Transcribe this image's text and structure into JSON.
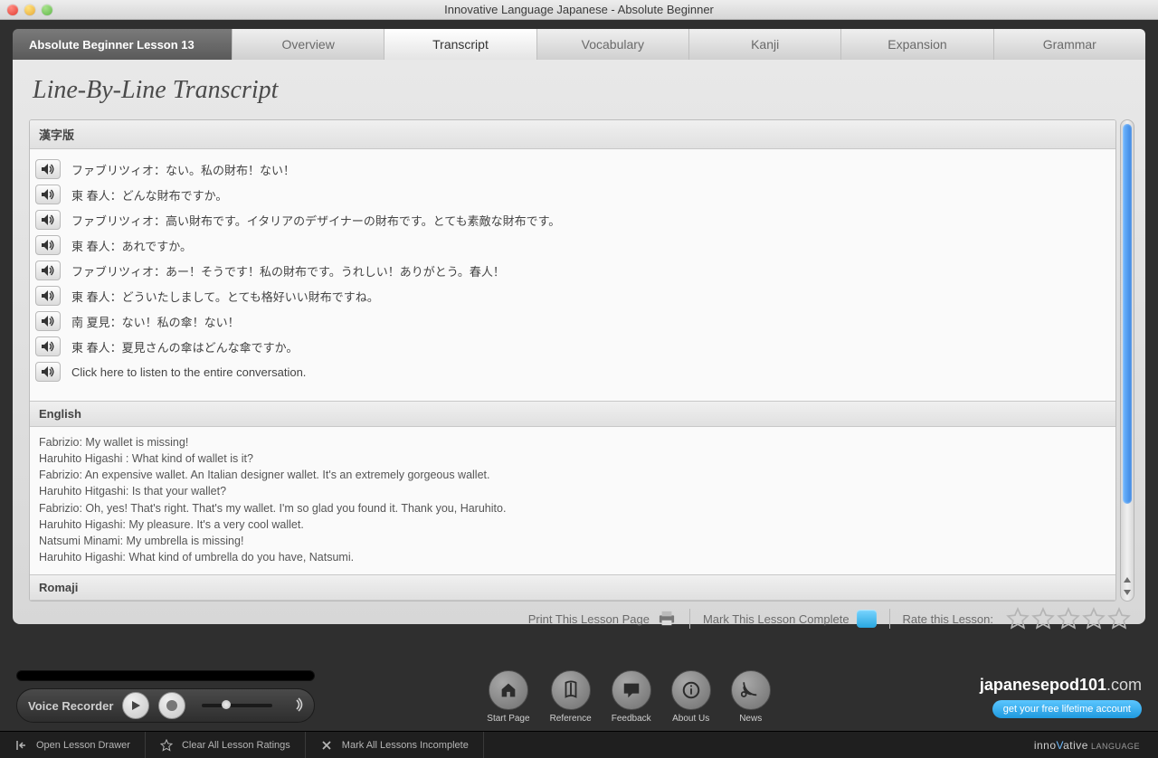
{
  "window": {
    "title": "Innovative Language Japanese - Absolute Beginner"
  },
  "lesson_tag": "Absolute Beginner Lesson 13",
  "tabs": [
    "Overview",
    "Transcript",
    "Vocabulary",
    "Kanji",
    "Expansion",
    "Grammar"
  ],
  "active_tab": 1,
  "page_title": "Line-By-Line Transcript",
  "sections": {
    "kanji": {
      "header": "漢字版",
      "lines": [
        "ファブリツィオ：ない。私の財布！ない！",
        "東 春人：どんな財布ですか。",
        "ファブリツィオ：高い財布です。イタリアのデザイナーの財布です。とても素敵な財布です。",
        "東 春人：あれですか。",
        "ファブリツィオ：あー！そうです！私の財布です。うれしい！ありがとう。春人！",
        "東 春人：どういたしまして。とても格好いい財布ですね。",
        "南 夏見：ない！私の傘！ない！",
        "東 春人：夏見さんの傘はどんな傘ですか。",
        "Click here to listen to the entire conversation."
      ]
    },
    "english": {
      "header": "English",
      "lines": [
        "Fabrizio: My wallet is missing!",
        "Haruhito Higashi : What kind of wallet is it?",
        "Fabrizio: An expensive wallet. An Italian designer wallet. It's an extremely gorgeous wallet.",
        "Haruhito Hitgashi: Is that your wallet?",
        "Fabrizio: Oh, yes! That's right. That's my wallet. I'm so glad you found it. Thank you, Haruhito.",
        "Haruhito Higashi: My pleasure. It's a very cool wallet.",
        "Natsumi Minami: My umbrella is missing!",
        "Haruhito Higashi: What kind of umbrella do you have, Natsumi."
      ]
    },
    "romaji": {
      "header": "Romaji"
    }
  },
  "footer": {
    "print": "Print This Lesson Page",
    "mark_complete": "Mark This Lesson Complete",
    "rate": "Rate this Lesson:"
  },
  "recorder_label": "Voice Recorder",
  "nav": [
    {
      "id": "start-page",
      "label": "Start Page"
    },
    {
      "id": "reference",
      "label": "Reference"
    },
    {
      "id": "feedback",
      "label": "Feedback"
    },
    {
      "id": "about-us",
      "label": "About Us"
    },
    {
      "id": "news",
      "label": "News"
    }
  ],
  "brand_site": {
    "bold": "japanesepod101",
    "rest": ".com"
  },
  "cta": "get your free lifetime account",
  "bottombar": {
    "open_drawer": "Open Lesson Drawer",
    "clear_ratings": "Clear All Lesson Ratings",
    "mark_incomplete": "Mark All Lessons Incomplete",
    "brand_pre": "inno",
    "brand_accent": "V",
    "brand_post": "ative",
    "brand_suffix": " LANGUAGE"
  }
}
